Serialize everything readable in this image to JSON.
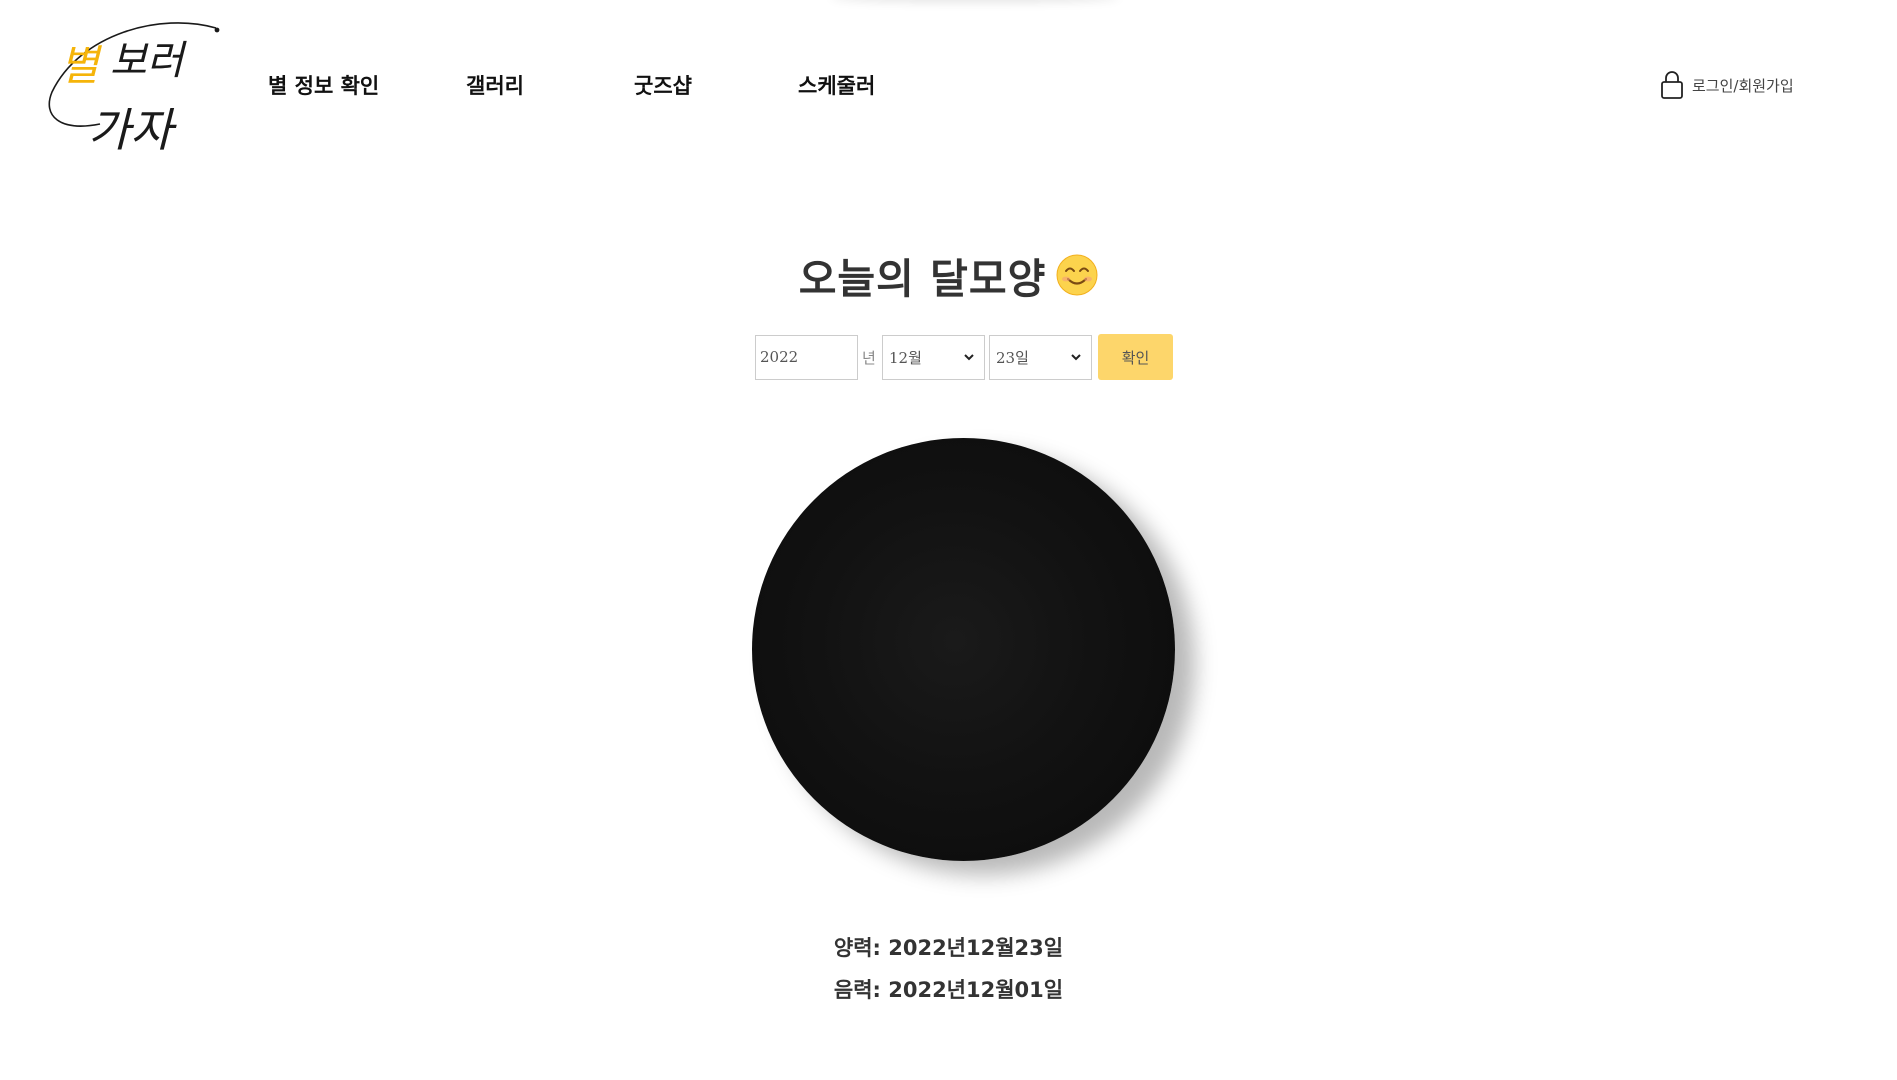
{
  "brand": {
    "logo_line1_highlight": "별",
    "logo_line1_rest": "보러",
    "logo_line2": "가자",
    "logo_highlight_color": "#f5b40a",
    "logo_ink_color": "#1a1a1a"
  },
  "nav": {
    "items": [
      {
        "label": "별 정보 확인"
      },
      {
        "label": "갤러리"
      },
      {
        "label": "굿즈샵"
      },
      {
        "label": "스케줄러"
      }
    ]
  },
  "auth": {
    "icon": "lock-icon",
    "label": "로그인/회원가입"
  },
  "main": {
    "title": "오늘의 달모양",
    "title_icon": "smiling-face-icon"
  },
  "form": {
    "year_value": "2022",
    "year_unit": "년",
    "month_selected": "12월",
    "day_selected": "23일",
    "confirm_label": "확인",
    "confirm_color": "#fdd66b"
  },
  "moon": {
    "phase": "new-moon",
    "color": "#111111"
  },
  "result": {
    "solar": "양력: 2022년12월23일",
    "lunar": "음력: 2022년12월01일"
  }
}
